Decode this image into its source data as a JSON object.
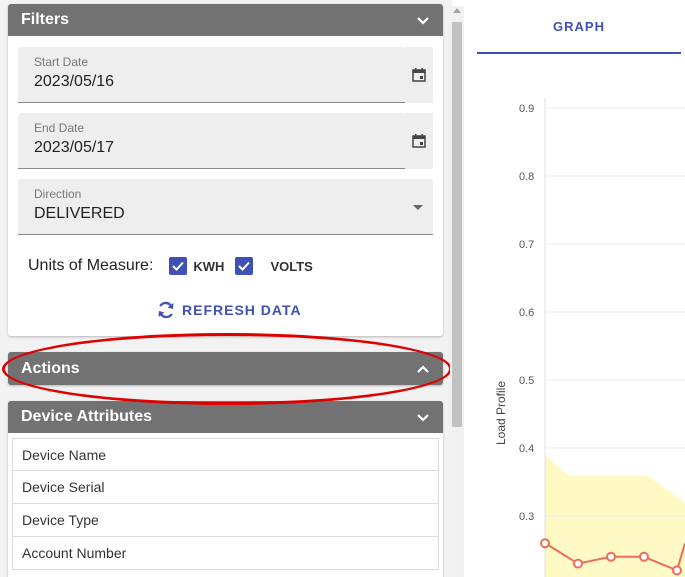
{
  "filters": {
    "title": "Filters",
    "start_date": {
      "label": "Start Date",
      "value": "2023/05/16"
    },
    "end_date": {
      "label": "End Date",
      "value": "2023/05/17"
    },
    "direction": {
      "label": "Direction",
      "value": "DELIVERED"
    },
    "units_label": "Units of Measure:",
    "units": [
      {
        "label": "KWH",
        "checked": true
      },
      {
        "label": "VOLTS",
        "checked": true
      }
    ],
    "refresh_label": "REFRESH DATA"
  },
  "actions": {
    "title": "Actions"
  },
  "device_attributes": {
    "title": "Device Attributes",
    "rows": [
      "Device Name",
      "Device Serial",
      "Device Type",
      "Account Number"
    ]
  },
  "graph": {
    "tab_label": "GRAPH"
  },
  "chart_data": {
    "type": "line",
    "ylabel": "Load Profile",
    "ylim": [
      0.2,
      0.9
    ],
    "yticks": [
      "0.9",
      "0.8",
      "0.7",
      "0.6",
      "0.5",
      "0.4",
      "0.3"
    ],
    "series": [
      {
        "values": [
          0.26,
          0.23,
          0.24,
          0.24,
          0.22,
          0.26
        ],
        "color": "#f06b5f"
      }
    ],
    "band": {
      "values": [
        0.39,
        0.36,
        0.36,
        0.36,
        0.32
      ],
      "color": "#fff9c4"
    }
  },
  "colors": {
    "accent": "#3f51b5",
    "header_bg": "#727272",
    "highlight": "#e00000"
  }
}
